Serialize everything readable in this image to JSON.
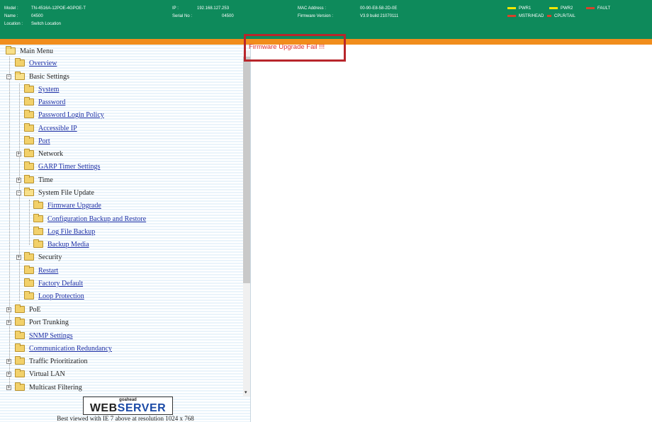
{
  "header": {
    "model_label": "Model :",
    "model_value": "TN-4516A-12POE-4GPOE-T",
    "name_label": "Name :",
    "name_value": "04500",
    "location_label": "Location :",
    "location_value": "Switch Location",
    "ip_label": "IP :",
    "ip_value": "192.168.127.253",
    "serial_label": "Serial No :",
    "serial_value": "04500",
    "mac_label": "MAC Address :",
    "mac_value": "00-90-E8-58-2D-0E",
    "firmware_label": "Firmware Version :",
    "firmware_value": "V3.9 build 21070111",
    "leds": {
      "pwr1": "PWR1",
      "pwr2": "PWR2",
      "fault": "FAULT",
      "mstr_head": "MSTR/HEAD",
      "cplr_tail": "CPLR/TAIL"
    },
    "colors": {
      "header_bg": "#0e8a5b",
      "accent_bar": "#f18d1c",
      "led_on": "#f3e600",
      "led_off": "#d9412b"
    }
  },
  "menu": {
    "main": "Main Menu",
    "overview": "Overview",
    "basic_settings": "Basic Settings",
    "system": "System",
    "password": "Password",
    "password_login_policy": "Password Login Policy",
    "accessible_ip": "Accessible IP",
    "port": "Port",
    "network": "Network",
    "garp": "GARP Timer Settings",
    "time": "Time",
    "system_file_update": "System File Update",
    "firmware_upgrade": "Firmware Upgrade",
    "config_backup": "Configuration Backup and Restore",
    "log_backup": "Log File Backup",
    "backup_media": "Backup Media",
    "security": "Security",
    "restart": "Restart",
    "factory_default": "Factory Default",
    "loop_protection": "Loop Protection",
    "poe": "PoE",
    "port_trunking": "Port Trunking",
    "snmp": "SNMP Settings",
    "comm_redundancy": "Communication Redundancy",
    "traffic_prio": "Traffic Prioritization",
    "vlan": "Virtual LAN",
    "multicast": "Multicast Filtering"
  },
  "footer": {
    "logo_top": "goahead",
    "logo_web": "WEB",
    "logo_server": "SERVER",
    "best_viewed": "Best viewed with IE 7 above at resolution 1024 x 768"
  },
  "content": {
    "message": "Firmware Upgrade Fail !!!",
    "message_color": "#e12f2f"
  }
}
